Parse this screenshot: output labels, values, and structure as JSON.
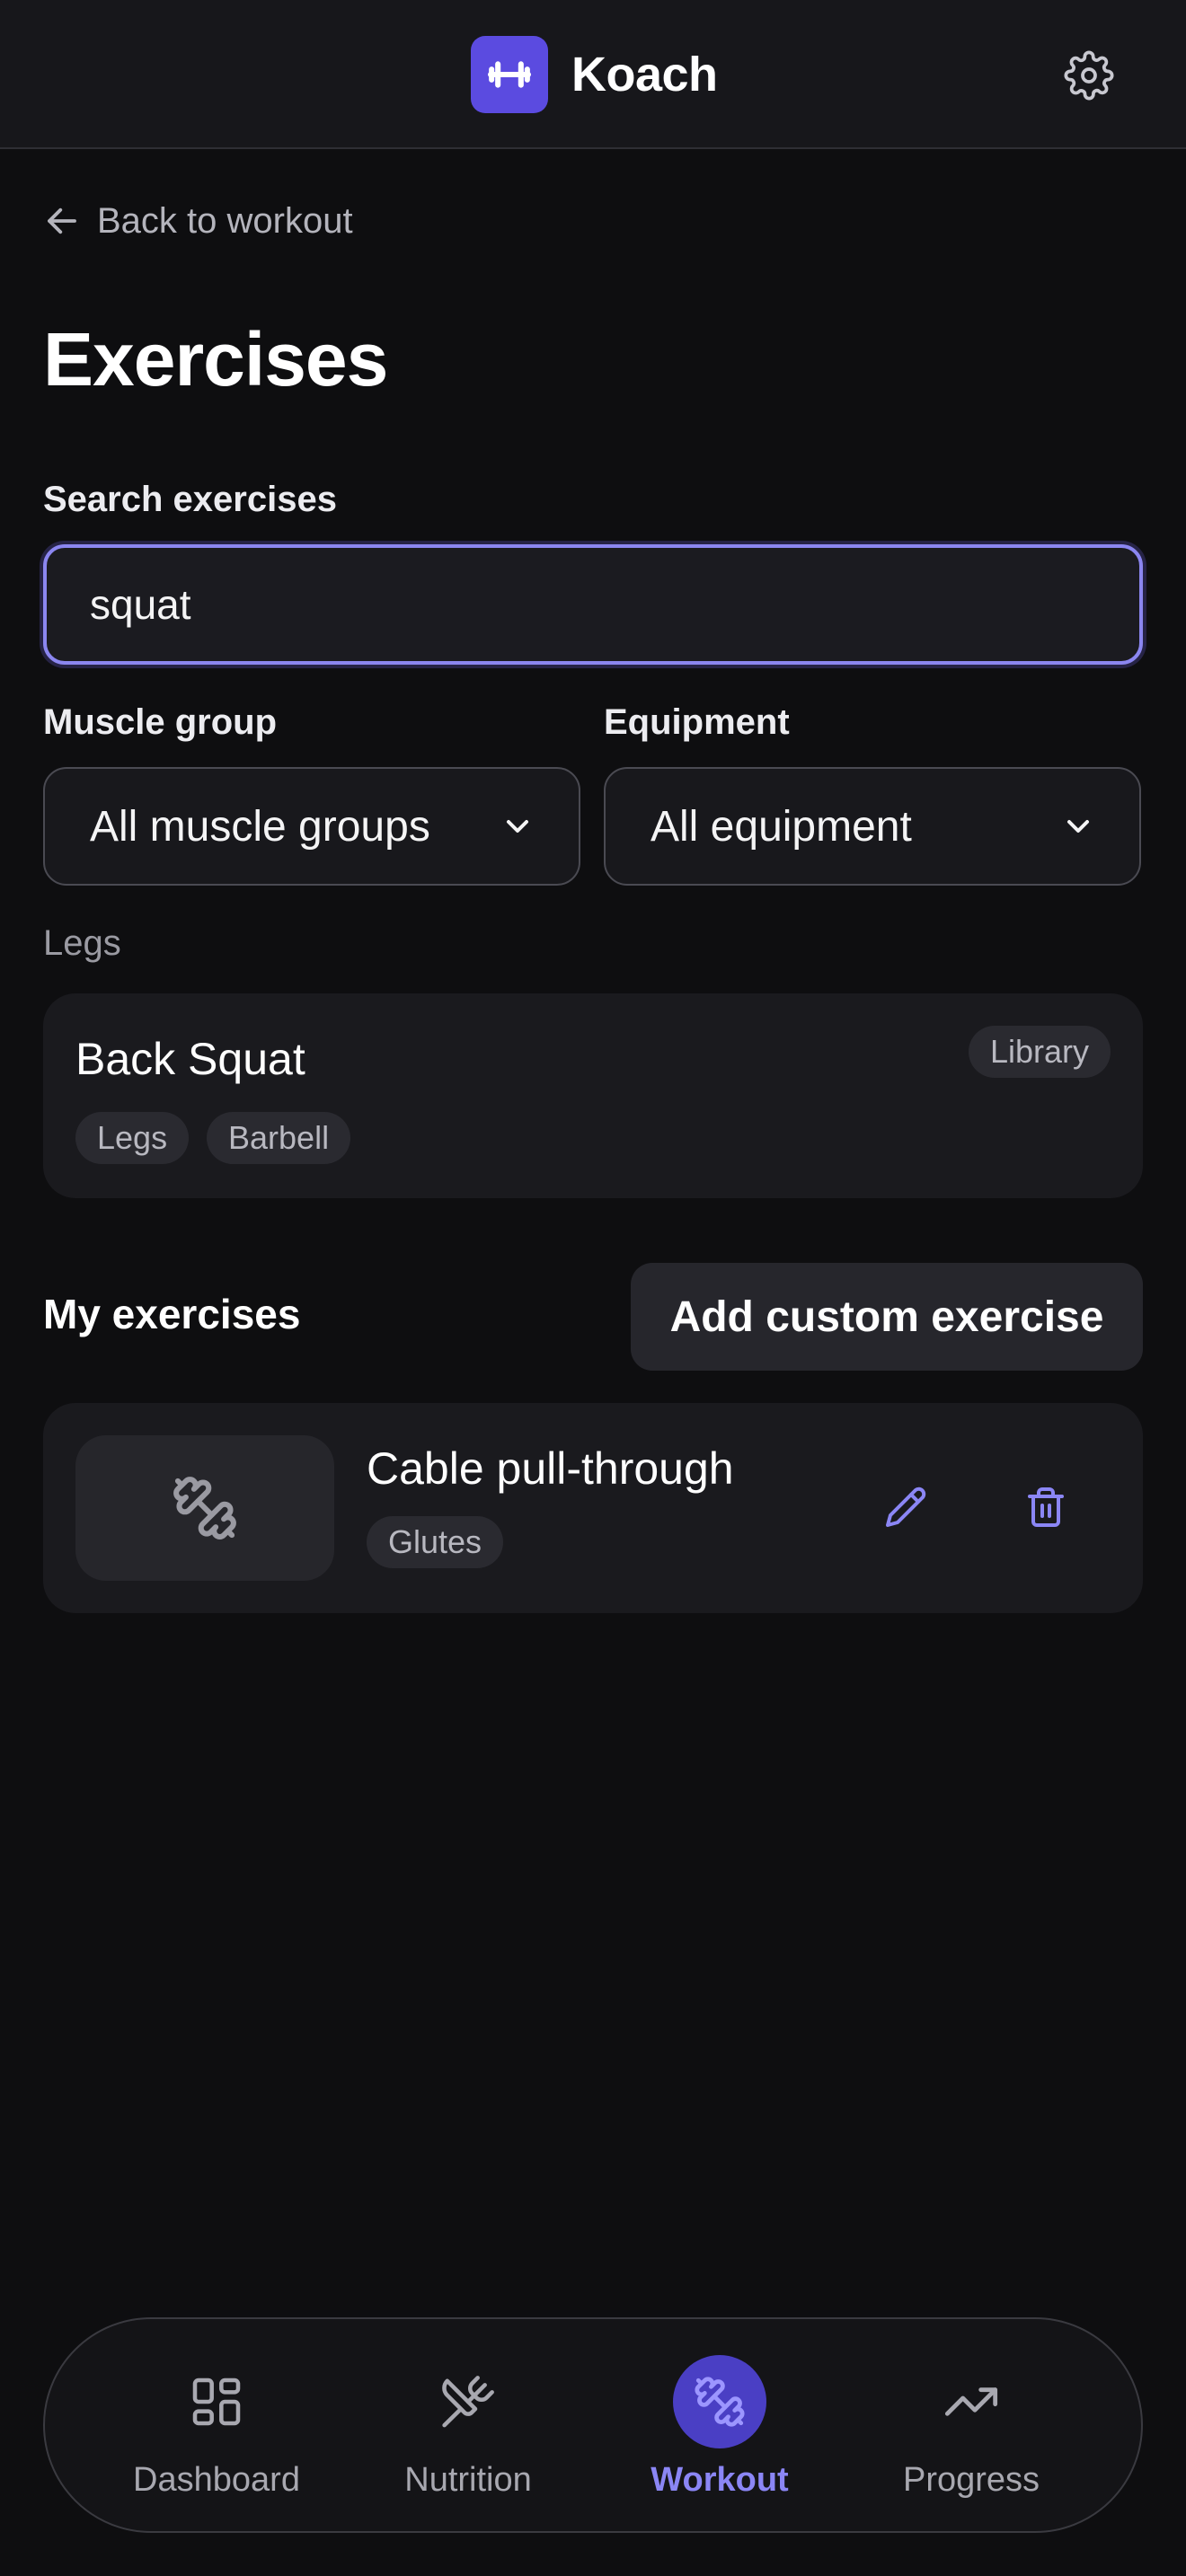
{
  "app": {
    "name": "Koach",
    "logo_icon": "dumbbell-icon",
    "accent": "#5b4be0",
    "settings_icon": "gear-icon"
  },
  "back_link": {
    "label": "Back to workout",
    "icon": "arrow-left-icon"
  },
  "page_title": "Exercises",
  "search": {
    "label": "Search exercises",
    "value": "squat",
    "placeholder": ""
  },
  "filters": {
    "muscle": {
      "label": "Muscle group",
      "value": "All muscle groups"
    },
    "equipment": {
      "label": "Equipment",
      "value": "All equipment"
    }
  },
  "library": {
    "group_label": "Legs",
    "items": [
      {
        "title": "Back Squat",
        "badge": "Library",
        "tags": [
          "Legs",
          "Barbell"
        ]
      }
    ]
  },
  "my_exercises": {
    "title": "My exercises",
    "add_label": "Add custom exercise",
    "items": [
      {
        "title": "Cable pull-through",
        "tags": [
          "Glutes"
        ],
        "thumb_icon": "dumbbell-icon",
        "edit_icon": "pencil-icon",
        "delete_icon": "trash-icon"
      }
    ]
  },
  "nav": {
    "active": "Workout",
    "items": [
      {
        "label": "Dashboard",
        "icon": "dashboard-icon"
      },
      {
        "label": "Nutrition",
        "icon": "fork-knife-icon"
      },
      {
        "label": "Workout",
        "icon": "dumbbell-icon"
      },
      {
        "label": "Progress",
        "icon": "trending-up-icon"
      }
    ]
  }
}
